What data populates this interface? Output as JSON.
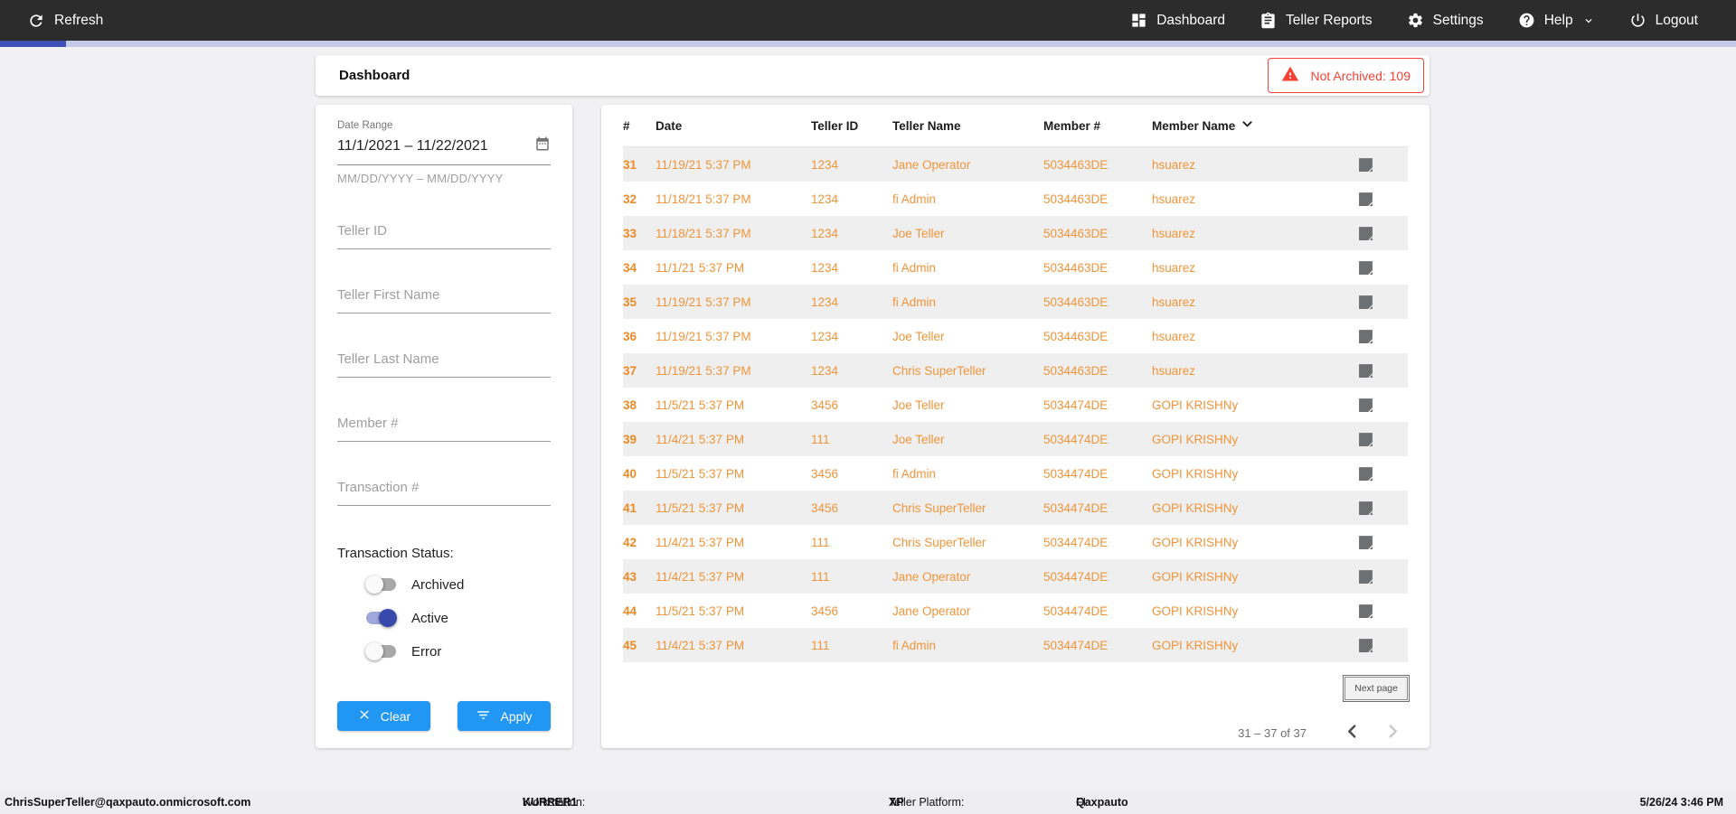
{
  "colors": {
    "nav_bg": "#2c2c2c",
    "accent_blue": "#2196f3",
    "progress_blue": "#3f51b5",
    "progress_track": "#c5cae9",
    "toggle_on": "#3949ab",
    "table_orange": "#f0943a",
    "alert_red": "#f44336"
  },
  "topnav": {
    "refresh_label": "Refresh",
    "refresh_icon": "refresh-icon",
    "items": [
      {
        "label": "Dashboard",
        "icon": "dashboard-grid-icon"
      },
      {
        "label": "Teller Reports",
        "icon": "clipboard-icon"
      },
      {
        "label": "Settings",
        "icon": "gear-icon"
      },
      {
        "label": "Help",
        "icon": "help-circle-icon",
        "chevron": "chevron-down-icon"
      },
      {
        "label": "Logout",
        "icon": "power-icon"
      }
    ]
  },
  "header": {
    "title": "Dashboard",
    "alert_text": "Not Archived: 109",
    "alert_icon": "warning-triangle-icon"
  },
  "filters": {
    "date_range": {
      "label": "Date Range",
      "value": "11/1/2021 – 11/22/2021",
      "hint": "MM/DD/YYYY – MM/DD/YYYY",
      "icon": "calendar-icon"
    },
    "fields": [
      {
        "placeholder": "Teller ID"
      },
      {
        "placeholder": "Teller First Name"
      },
      {
        "placeholder": "Teller Last Name"
      },
      {
        "placeholder": "Member #"
      },
      {
        "placeholder": "Transaction #"
      }
    ],
    "status_label": "Transaction Status:",
    "toggles": [
      {
        "label": "Archived",
        "on": false
      },
      {
        "label": "Active",
        "on": true
      },
      {
        "label": "Error",
        "on": false
      }
    ],
    "clear_label": "Clear",
    "apply_label": "Apply"
  },
  "table": {
    "columns": {
      "num": "#",
      "date": "Date",
      "teller_id": "Teller ID",
      "teller_name": "Teller Name",
      "member_num": "Member #",
      "member_name": "Member Name"
    },
    "sort": {
      "column": "Member Name",
      "direction": "desc",
      "icon": "sort-chevron-down-icon"
    },
    "row_icon": "note-icon",
    "rows": [
      {
        "n": "31",
        "date": "11/19/21 5:37 PM",
        "teller_id": "1234",
        "teller_name": "Jane Operator",
        "member_num": "5034463DE",
        "member_name": "hsuarez"
      },
      {
        "n": "32",
        "date": "11/18/21 5:37 PM",
        "teller_id": "1234",
        "teller_name": "fi Admin",
        "member_num": "5034463DE",
        "member_name": "hsuarez"
      },
      {
        "n": "33",
        "date": "11/18/21 5:37 PM",
        "teller_id": "1234",
        "teller_name": "Joe Teller",
        "member_num": "5034463DE",
        "member_name": "hsuarez"
      },
      {
        "n": "34",
        "date": "11/1/21 5:37 PM",
        "teller_id": "1234",
        "teller_name": "fi Admin",
        "member_num": "5034463DE",
        "member_name": "hsuarez"
      },
      {
        "n": "35",
        "date": "11/19/21 5:37 PM",
        "teller_id": "1234",
        "teller_name": "fi Admin",
        "member_num": "5034463DE",
        "member_name": "hsuarez"
      },
      {
        "n": "36",
        "date": "11/19/21 5:37 PM",
        "teller_id": "1234",
        "teller_name": "Joe Teller",
        "member_num": "5034463DE",
        "member_name": "hsuarez"
      },
      {
        "n": "37",
        "date": "11/19/21 5:37 PM",
        "teller_id": "1234",
        "teller_name": "Chris SuperTeller",
        "member_num": "5034463DE",
        "member_name": "hsuarez"
      },
      {
        "n": "38",
        "date": "11/5/21 5:37 PM",
        "teller_id": "3456",
        "teller_name": "Joe Teller",
        "member_num": "5034474DE",
        "member_name": "GOPI KRISHNy"
      },
      {
        "n": "39",
        "date": "11/4/21 5:37 PM",
        "teller_id": "111",
        "teller_name": "Joe Teller",
        "member_num": "5034474DE",
        "member_name": "GOPI KRISHNy"
      },
      {
        "n": "40",
        "date": "11/5/21 5:37 PM",
        "teller_id": "3456",
        "teller_name": "fi Admin",
        "member_num": "5034474DE",
        "member_name": "GOPI KRISHNy"
      },
      {
        "n": "41",
        "date": "11/5/21 5:37 PM",
        "teller_id": "3456",
        "teller_name": "Chris SuperTeller",
        "member_num": "5034474DE",
        "member_name": "GOPI KRISHNy"
      },
      {
        "n": "42",
        "date": "11/4/21 5:37 PM",
        "teller_id": "111",
        "teller_name": "Chris SuperTeller",
        "member_num": "5034474DE",
        "member_name": "GOPI KRISHNy"
      },
      {
        "n": "43",
        "date": "11/4/21 5:37 PM",
        "teller_id": "111",
        "teller_name": "Jane Operator",
        "member_num": "5034474DE",
        "member_name": "GOPI KRISHNy"
      },
      {
        "n": "44",
        "date": "11/5/21 5:37 PM",
        "teller_id": "3456",
        "teller_name": "Jane Operator",
        "member_num": "5034474DE",
        "member_name": "GOPI KRISHNy"
      },
      {
        "n": "45",
        "date": "11/4/21 5:37 PM",
        "teller_id": "111",
        "teller_name": "fi Admin",
        "member_num": "5034474DE",
        "member_name": "GOPI KRISHNy"
      }
    ]
  },
  "pagination": {
    "next_label": "Next page",
    "range_text": "31 – 37 of 37",
    "prev_icon": "chevron-left-icon",
    "next_icon": "chevron-right-icon"
  },
  "footer": {
    "user": "ChrisSuperTeller@qaxpauto.onmicrosoft.com",
    "workstation_label": "Workstation: ",
    "workstation_value": "KURRER1",
    "platform_label": "Teller Platform: ",
    "platform_value": "XP",
    "fi_label": "FI: ",
    "fi_value": "Qaxpauto",
    "datetime": "5/26/24 3:46 PM"
  }
}
